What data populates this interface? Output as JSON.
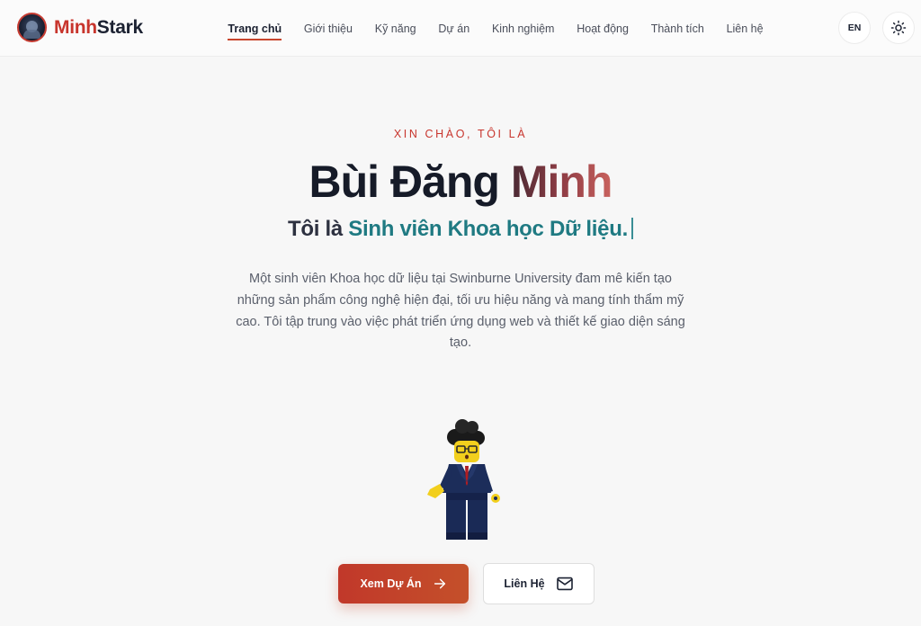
{
  "header": {
    "logo": {
      "part1": "Minh",
      "part2": "Stark"
    },
    "nav": [
      {
        "label": "Trang chủ",
        "active": true
      },
      {
        "label": "Giới thiệu",
        "active": false
      },
      {
        "label": "Kỹ năng",
        "active": false
      },
      {
        "label": "Dự án",
        "active": false
      },
      {
        "label": "Kinh nghiệm",
        "active": false
      },
      {
        "label": "Hoạt động",
        "active": false
      },
      {
        "label": "Thành tích",
        "active": false
      },
      {
        "label": "Liên hệ",
        "active": false
      }
    ],
    "lang_label": "EN",
    "theme_icon": "sun-icon"
  },
  "hero": {
    "eyebrow": "XIN CHÀO, TÔI LÀ",
    "name_first": "Bùi Đăng ",
    "name_accent": "Minh",
    "sub_prefix": "Tôi là ",
    "sub_role": "Sinh viên Khoa học Dữ liệu.",
    "description": "Một sinh viên Khoa học dữ liệu tại Swinburne University đam mê kiến tạo những sản phẩm công nghệ hiện đại, tối ưu hiệu năng và mang tính thẩm mỹ cao. Tôi tập trung vào việc phát triển ứng dụng web và thiết kế giao diện sáng tạo."
  },
  "actions": {
    "primary_label": "Xem Dự Án",
    "primary_icon": "arrow-right-icon",
    "secondary_label": "Liên Hệ",
    "secondary_icon": "mail-icon"
  },
  "colors": {
    "accent_red": "#c8352d",
    "accent_teal": "#1f7a82",
    "text_dark": "#161b28"
  }
}
